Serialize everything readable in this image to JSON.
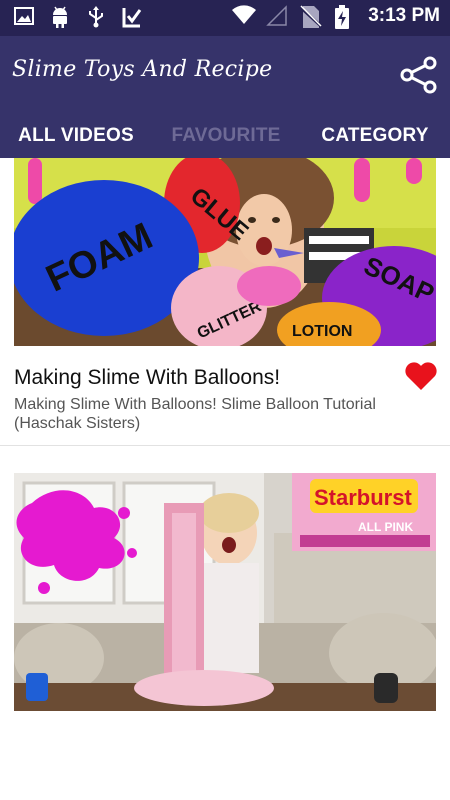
{
  "status_bar": {
    "time": "3:13 PM",
    "icons": [
      "image-icon",
      "android-icon",
      "usb-icon",
      "checkmark-app-icon",
      "wifi-icon",
      "signal-icon",
      "no-sim-icon",
      "battery-charging-icon"
    ]
  },
  "app_bar": {
    "title": "Slime Toys And Recipe",
    "share_icon": "share-icon"
  },
  "tabs": [
    {
      "label": "ALL VIDEOS",
      "active": true
    },
    {
      "label": "FAVOURITE",
      "active": false
    },
    {
      "label": "CATEGORY",
      "active": false
    }
  ],
  "videos": [
    {
      "title": "Making Slime With Balloons!",
      "description": "Making Slime With Balloons! Slime Balloon Tutorial (Haschak Sisters)",
      "favourite": true,
      "thumbnail_text": [
        "FOAM",
        "GLUE",
        "SOAP",
        "LOTION",
        "GLITTER"
      ]
    },
    {
      "thumbnail_text": [
        "Starburst",
        "ALL PINK"
      ]
    }
  ],
  "colors": {
    "status_bar": "#272353",
    "app_bar": "#36336a",
    "tab_inactive": "#6e6a96",
    "heart": "#e8121c"
  }
}
